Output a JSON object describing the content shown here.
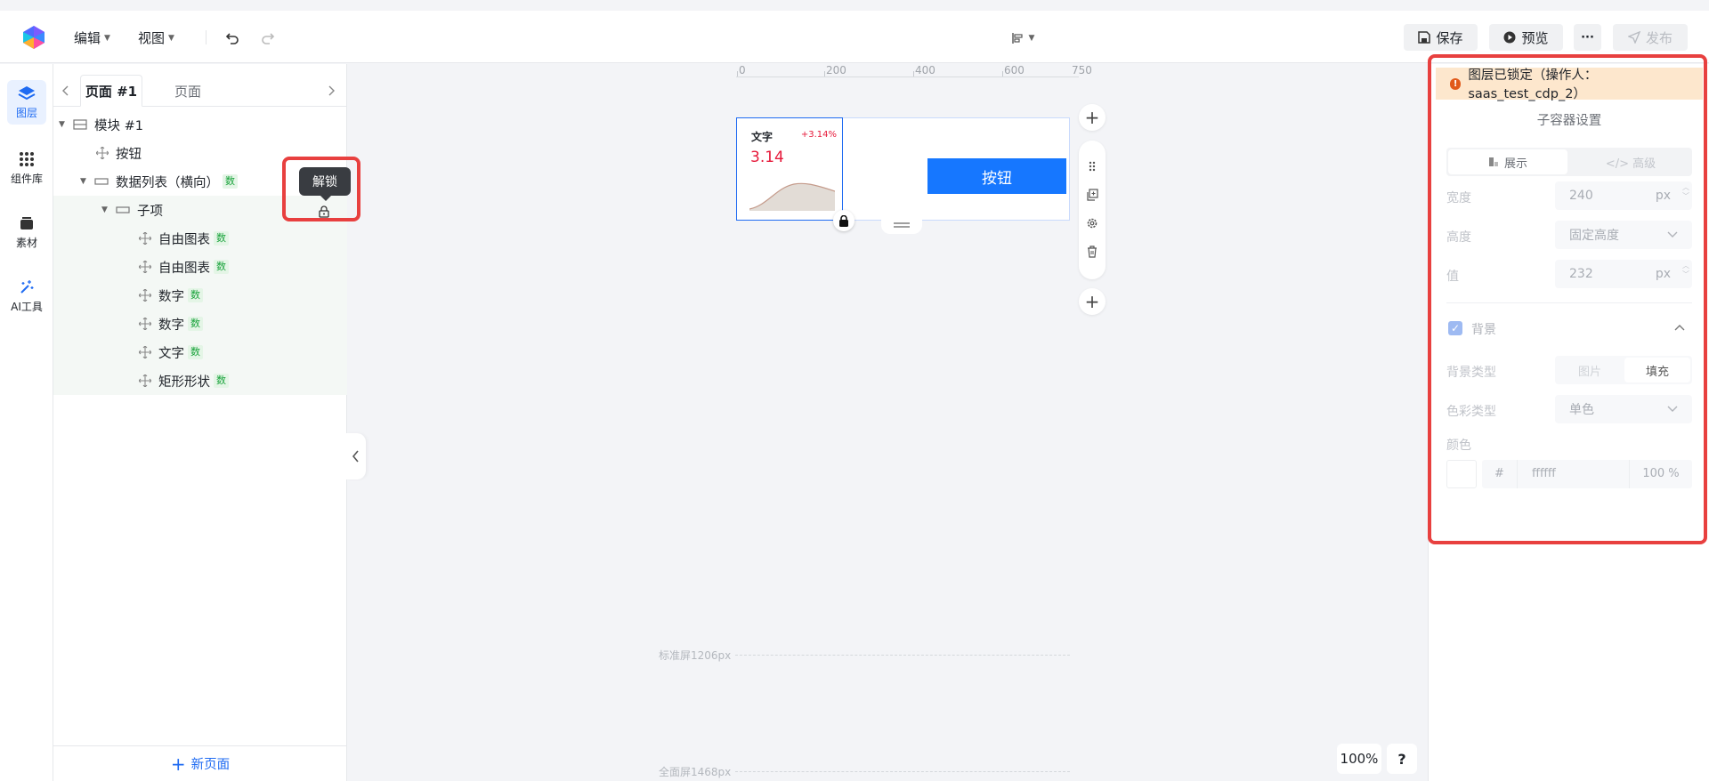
{
  "topbar": {
    "menu_edit": "编辑",
    "menu_view": "视图",
    "save_label": "保存",
    "preview_label": "预览",
    "more_label": "···",
    "publish_label": "发布"
  },
  "sidebar": {
    "items": [
      {
        "label": "图层"
      },
      {
        "label": "组件库"
      },
      {
        "label": "素材"
      },
      {
        "label": "AI工具"
      }
    ]
  },
  "layers": {
    "tab_active": "页面 #1",
    "tab_other": "页面",
    "tree": [
      {
        "label": "模块 #1",
        "badge": ""
      },
      {
        "label": "按钮",
        "badge": ""
      },
      {
        "label": "数据列表（横向）",
        "badge": "数"
      },
      {
        "label": "子项",
        "badge": ""
      },
      {
        "label": "自由图表",
        "badge": "数"
      },
      {
        "label": "自由图表",
        "badge": "数"
      },
      {
        "label": "数字",
        "badge": "数"
      },
      {
        "label": "数字",
        "badge": "数"
      },
      {
        "label": "文字",
        "badge": "数"
      },
      {
        "label": "矩形形状",
        "badge": "数"
      }
    ],
    "tooltip": "解锁",
    "new_page": "新页面"
  },
  "canvas": {
    "ruler": [
      "0",
      "200",
      "400",
      "600",
      "750"
    ],
    "card": {
      "title": "文字",
      "change": "+3.14%",
      "value": "3.14"
    },
    "button_label": "按钮",
    "guide_standard": "标准屏1206px",
    "guide_full": "全面屏1468px",
    "zoom": "100%",
    "help": "?"
  },
  "panel": {
    "lock_notice": "图层已锁定（操作人：saas_test_cdp_2）",
    "title": "子容器设置",
    "tab_display": "展示",
    "tab_interaction": "</> 高级",
    "width_label": "宽度",
    "width_value": "240",
    "width_unit": "px",
    "height_label": "高度",
    "height_value": "固定高度",
    "value_label": "值",
    "value_value": "232",
    "value_unit": "px",
    "background_label": "背景",
    "bg_type_label": "背景类型",
    "bg_type_image": "图片",
    "bg_type_fill": "填充",
    "color_type_label": "色彩类型",
    "color_type_value": "单色",
    "color_label": "颜色",
    "color_hash": "#",
    "color_hex": "ffffff",
    "color_opacity": "100 %"
  },
  "colors": {
    "accent": "#1677ff",
    "highlight": "#e8403f",
    "lock_bg": "#fde7cd",
    "badge_green": "#19a33b",
    "change_red": "#e6193a"
  }
}
